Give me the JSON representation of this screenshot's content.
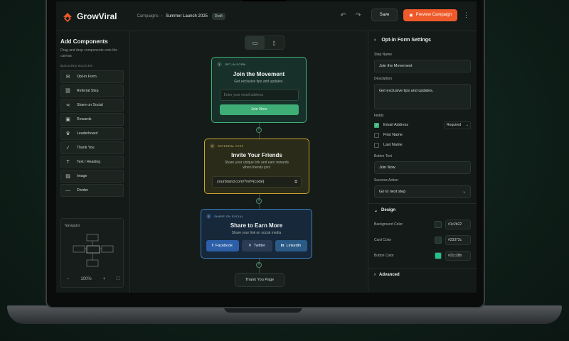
{
  "app": {
    "name": "GrowViral",
    "brand_color": "#ef5a2a",
    "accent_green": "#3fae76"
  },
  "topbar": {
    "crumb_root": "Campaigns",
    "crumb_current": "Summer Launch 2025",
    "status_badge": "Draft",
    "save_label": "Save",
    "preview_label": "Preview Campaign",
    "icons": [
      "undo-icon",
      "redo-icon",
      "more-icon"
    ]
  },
  "left": {
    "title": "Add Components",
    "subtitle": "Drag and drop components onto the canvas",
    "section": "BUILDING BLOCKS",
    "items": [
      {
        "label": "Opt-in Form",
        "icon": "mail-icon"
      },
      {
        "label": "Referral Step",
        "icon": "link-icon"
      },
      {
        "label": "Share on Social",
        "icon": "share-icon"
      },
      {
        "label": "Rewards",
        "icon": "gift-icon"
      },
      {
        "label": "Leaderboard",
        "icon": "trophy-icon"
      },
      {
        "label": "Thank You",
        "icon": "check-circle-icon"
      },
      {
        "label": "Text / Heading",
        "icon": "text-icon"
      },
      {
        "label": "Image",
        "icon": "image-icon"
      },
      {
        "label": "Divider",
        "icon": "divider-icon"
      }
    ],
    "navigator": {
      "title": "Navigator",
      "zoom": "100%"
    }
  },
  "canvas": {
    "step1": {
      "num": "1",
      "tag": "OPT-IN FORM",
      "title": "Join the Movement",
      "desc": "Get exclusive tips and updates.",
      "placeholder": "Enter your email address",
      "button": "Join Now"
    },
    "step2": {
      "num": "2",
      "tag": "REFERRAL STEP",
      "title": "Invite Your Friends",
      "desc": "Share your unique link and earn rewards when friends join!",
      "link": "yourbrand.com/?ref={code}"
    },
    "step3": {
      "num": "3",
      "tag": "SHARE ON SOCIAL",
      "title": "Share to Earn More",
      "desc": "Share your link on social media",
      "buttons": [
        "Facebook",
        "Twitter",
        "LinkedIn"
      ]
    },
    "step4": {
      "title": "Thank You Page"
    }
  },
  "right": {
    "title": "Opt-in Form Settings",
    "step_name_label": "Step Name",
    "step_name": "Join the Movement",
    "desc_label": "Description",
    "desc": "Get exclusive tips and updates.",
    "fields_label": "Fields",
    "fields": [
      {
        "label": "Email Address",
        "checked": true,
        "req": "Required"
      },
      {
        "label": "First Name",
        "checked": false
      },
      {
        "label": "Last Name",
        "checked": false
      }
    ],
    "button_text_label": "Button Text",
    "button_text": "Join Now",
    "success_label": "Success Action",
    "success": "Go to next step",
    "design_label": "Design",
    "colors": [
      {
        "label": "Background Color",
        "hex": "#1c2b22"
      },
      {
        "label": "Card Color",
        "hex": "#23372c"
      },
      {
        "label": "Button Color",
        "hex": "#21c28b"
      }
    ],
    "advanced_label": "Advanced"
  }
}
